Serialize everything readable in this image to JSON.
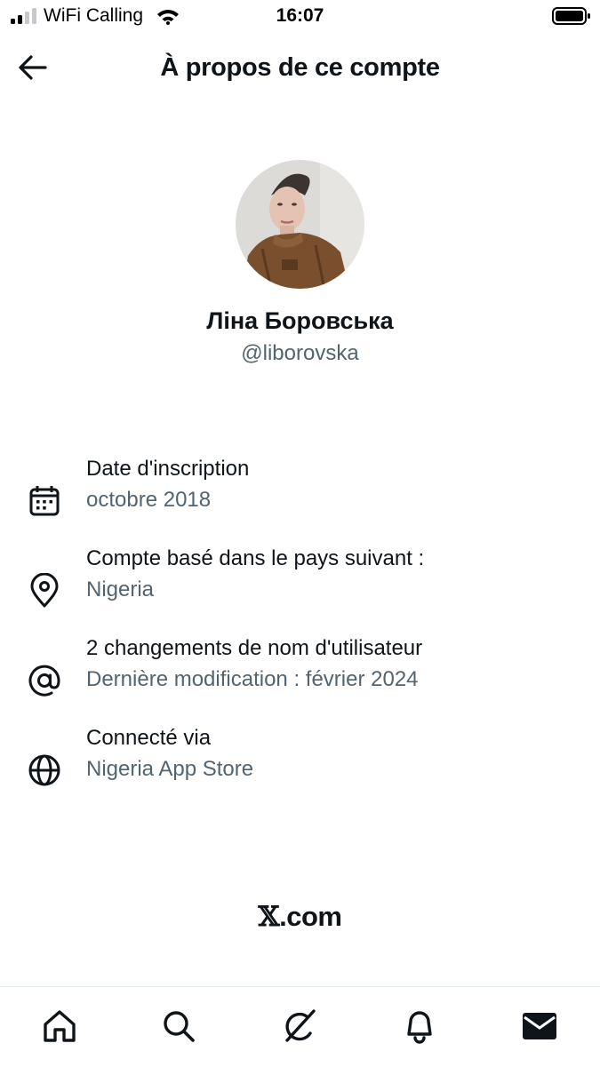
{
  "status_bar": {
    "carrier": "WiFi Calling",
    "time": "16:07"
  },
  "header": {
    "title": "À propos de ce compte",
    "back_icon": "arrow-left-icon"
  },
  "profile": {
    "display_name": "Ліна Боровська",
    "handle": "@liborovska"
  },
  "info": [
    {
      "icon": "calendar-icon",
      "title": "Date d'inscription",
      "value": "octobre 2018"
    },
    {
      "icon": "location-pin-icon",
      "title": "Compte basé dans le pays suivant :",
      "value": "Nigeria"
    },
    {
      "icon": "at-sign-icon",
      "title": "2 changements de nom d'utilisateur",
      "value": "Dernière modification : février 2024"
    },
    {
      "icon": "globe-icon",
      "title": "Connecté via",
      "value": "Nigeria App Store"
    }
  ],
  "footer": {
    "brand_mark": "𝕏",
    "brand_suffix": ".com"
  },
  "tab_bar": {
    "items": [
      "home-icon",
      "search-icon",
      "grok-icon",
      "notifications-bell-icon",
      "messages-envelope-icon"
    ],
    "active": "messages-envelope-icon"
  },
  "colors": {
    "text_primary": "#0f1419",
    "text_secondary": "#536471",
    "divider": "#e1e8ed"
  }
}
